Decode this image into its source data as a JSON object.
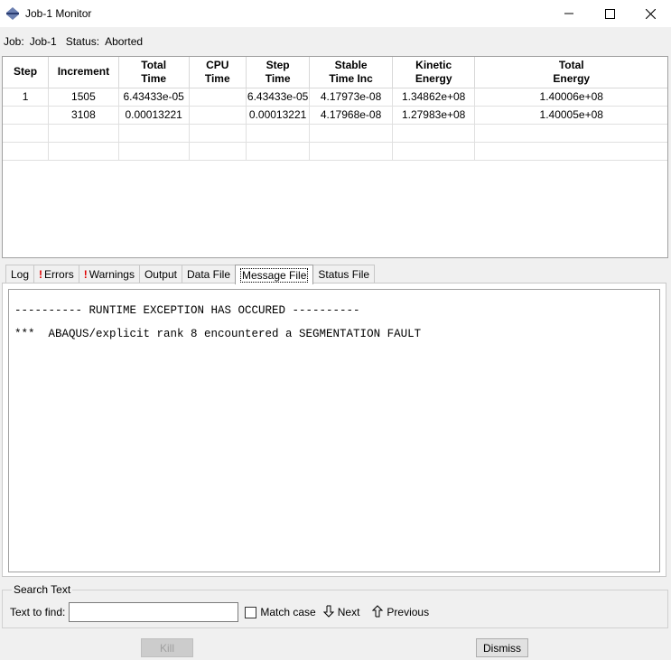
{
  "window": {
    "title": "Job-1 Monitor"
  },
  "status": {
    "job_label": "Job:",
    "job_value": "Job-1",
    "status_label": "Status:",
    "status_value": "Aborted"
  },
  "table": {
    "columns": [
      [
        "Step",
        ""
      ],
      [
        "Increment",
        ""
      ],
      [
        "Total",
        "Time"
      ],
      [
        "CPU",
        "Time"
      ],
      [
        "Step",
        "Time"
      ],
      [
        "Stable",
        "Time Inc"
      ],
      [
        "Kinetic",
        "Energy"
      ],
      [
        "Total",
        "Energy"
      ]
    ],
    "rows": [
      [
        "1",
        "1505",
        "6.43433e-05",
        "",
        "6.43433e-05",
        "4.17973e-08",
        "1.34862e+08",
        "1.40006e+08"
      ],
      [
        "",
        "3108",
        "0.00013221",
        "",
        "0.00013221",
        "4.17968e-08",
        "1.27983e+08",
        "1.40005e+08"
      ],
      [
        "",
        "",
        "",
        "",
        "",
        "",
        "",
        ""
      ],
      [
        "",
        "",
        "",
        "",
        "",
        "",
        "",
        ""
      ]
    ]
  },
  "tabs": [
    {
      "label": "Log",
      "warn": false
    },
    {
      "label": "Errors",
      "warn": true
    },
    {
      "label": "Warnings",
      "warn": true
    },
    {
      "label": "Output",
      "warn": false
    },
    {
      "label": "Data File",
      "warn": false
    },
    {
      "label": "Message File",
      "warn": false,
      "active": true
    },
    {
      "label": "Status File",
      "warn": false
    }
  ],
  "message": {
    "lines": [
      "---------- RUNTIME EXCEPTION HAS OCCURED ----------",
      "***  ABAQUS/explicit rank 8 encountered a SEGMENTATION FAULT"
    ]
  },
  "search": {
    "legend": "Search Text",
    "label": "Text to find:",
    "value": "",
    "match_case": "Match case",
    "next": "Next",
    "previous": "Previous"
  },
  "buttons": {
    "kill": "Kill",
    "dismiss": "Dismiss"
  },
  "colors": {
    "warning": "#e00000"
  }
}
